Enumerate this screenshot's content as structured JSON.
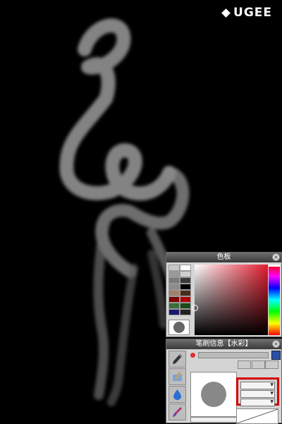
{
  "brand": {
    "logo_text": "UGEE"
  },
  "artwork": {
    "description_icon": "brush-stroke-figure"
  },
  "color_panel": {
    "title": "色板",
    "close_icon": "close-icon",
    "swatches": [
      "#c8c8c8",
      "#ffffff",
      "#999999",
      "#cfcfcf",
      "#7a7a7a",
      "#3a3a3a",
      "#8c8c8c",
      "#000000",
      "#a0806a",
      "#4a2a1a",
      "#7d0000",
      "#b00000",
      "#3d6d3d",
      "#1c4a1c",
      "#1a1a6d",
      "#222222"
    ],
    "current_color": "#666666",
    "accent": "#e31d2f"
  },
  "brush_panel": {
    "title": "笔刷信息【水彩】",
    "close_icon": "close-icon",
    "save_icon": "save-icon",
    "tools": [
      "pen-icon",
      "watercolor-icon",
      "drop-icon",
      "brush-icon"
    ]
  }
}
